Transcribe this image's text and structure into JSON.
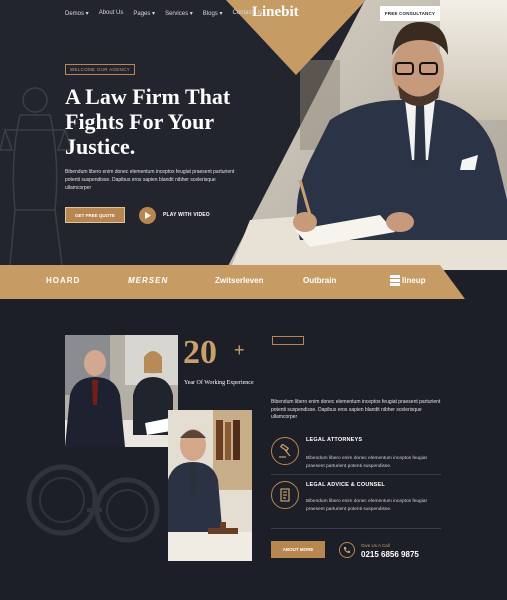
{
  "nav": {
    "items": [
      "Demos ▾",
      "About Us",
      "Pages ▾",
      "Services ▾",
      "Blogs ▾",
      "Contact Us"
    ],
    "logo": "Linebit",
    "consult_label": "FREE CONSULTANCY"
  },
  "hero": {
    "welcome": "WELCOME OUR AGENCY",
    "title": "A Law Firm That Fights For Your Justice.",
    "text": "Bibendum libero enim donec elementum inceptos feugiat praesent parturient potenti suspendisse. Dapibus eros sapien blandit nibher scelerisque ullamcorper",
    "quote_label": "GET FREE QUOTE",
    "video_label": "PLAY WITH VIDEO"
  },
  "brands": [
    "HOARD",
    "MERSEN",
    "Zwitserleven",
    "Outbrain",
    "lineup"
  ],
  "about": {
    "years": "20",
    "plus": "+",
    "years_label": "Year Of Working Experience",
    "text": "Bibendum libero enim donec elementum inceptos feugiat praesent parturient potenti suspendisse. Dapibus eros sapien blandit nibher scelerisque ullamcorper",
    "features": [
      {
        "title": "LEGAL ATTORNEYS",
        "text": "Bibendum libero enim donec elementum inceptos feugiat praesent parturient potenti suspendisse.",
        "icon": "gavel-icon"
      },
      {
        "title": "LEGAL ADVICE & COUNSEL",
        "text": "Bibendum libero enim donec elementum inceptos feugiat praesent parturient potenti suspendisse.",
        "icon": "document-icon"
      }
    ],
    "button_label": "ABOUT MORE",
    "call_label": "Give Us A Call",
    "phone": "0215 6856 9875"
  },
  "colors": {
    "accent": "#b8874f",
    "background": "#1c1f27",
    "hero_bg": "#22252d"
  }
}
